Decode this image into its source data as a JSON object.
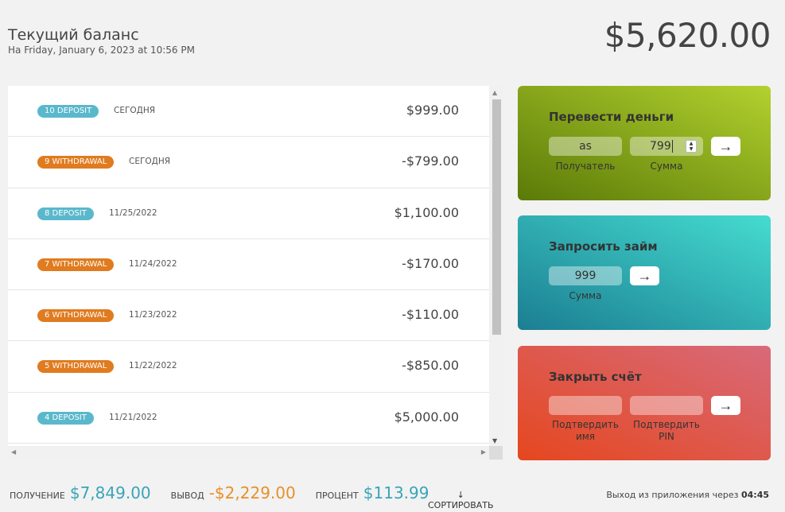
{
  "header": {
    "title": "Текущий баланс",
    "date": "Ha Friday, January 6, 2023 at 10:56 PM",
    "balance": "$5,620.00"
  },
  "movements": [
    {
      "badge": "10 DEPOSIT",
      "type": "deposit",
      "date": "СЕГОДНЯ",
      "value": "$999.00"
    },
    {
      "badge": "9 WITHDRAWAL",
      "type": "withdrawal",
      "date": "СЕГОДНЯ",
      "value": "-$799.00"
    },
    {
      "badge": "8 DEPOSIT",
      "type": "deposit",
      "date": "11/25/2022",
      "value": "$1,100.00"
    },
    {
      "badge": "7 WITHDRAWAL",
      "type": "withdrawal",
      "date": "11/24/2022",
      "value": "-$170.00"
    },
    {
      "badge": "6 WITHDRAWAL",
      "type": "withdrawal",
      "date": "11/23/2022",
      "value": "-$110.00"
    },
    {
      "badge": "5 WITHDRAWAL",
      "type": "withdrawal",
      "date": "11/22/2022",
      "value": "-$850.00"
    },
    {
      "badge": "4 DEPOSIT",
      "type": "deposit",
      "date": "11/21/2022",
      "value": "$5,000.00"
    }
  ],
  "transfer": {
    "title": "Перевести деньги",
    "recipient_value": "as",
    "recipient_label": "Получатель",
    "amount_value": "799",
    "amount_label": "Сумма",
    "button": "→"
  },
  "loan": {
    "title": "Запросить займ",
    "amount_value": "999",
    "amount_label": "Сумма",
    "button": "→"
  },
  "close": {
    "title": "Закрыть счёт",
    "user_label_1": "Подтвердить",
    "user_label_2": "имя",
    "pin_label_1": "Подтвердить",
    "pin_label_2": "PIN",
    "button": "→"
  },
  "summary": {
    "in_label": "ПОЛУЧЕНИЕ",
    "in_value": "$7,849.00",
    "out_label": "ВЫВОД",
    "out_value": "-$2,229.00",
    "interest_label": "ПРОЦЕНТ",
    "interest_value": "$113.99",
    "sort_arrow": "↓",
    "sort_label": "СОРТИРОВАТЬ"
  },
  "logout": {
    "text": "Выход из приложения через",
    "time": "04:45"
  },
  "colors": {
    "deposit": "#5ab8cc",
    "withdrawal": "#e07b1f",
    "summary_in": "#3aa4b8",
    "summary_out": "#e8902a"
  }
}
